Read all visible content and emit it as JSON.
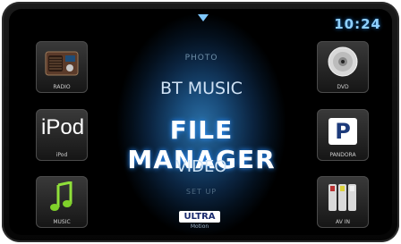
{
  "clock": "10:24",
  "menu": {
    "photo": "PHOTO",
    "bt_music": "BT MUSIC",
    "file_manager": "FILE MANAGER",
    "video": "VIDEO",
    "setup": "SET UP"
  },
  "left_tiles": [
    {
      "label": "RADIO",
      "icon": "radio-icon"
    },
    {
      "label": "iPod",
      "icon_text": "iPod",
      "icon": "ipod-icon"
    },
    {
      "label": "MUSIC",
      "icon": "music-note-icon"
    }
  ],
  "right_tiles": [
    {
      "label": "DVD",
      "icon": "disc-icon"
    },
    {
      "label": "PANDORA",
      "icon_text": "P",
      "icon": "pandora-icon"
    },
    {
      "label": "AV IN",
      "icon": "av-plugs-icon"
    }
  ],
  "logo": {
    "main": "ULTRA",
    "sub": "Motion"
  }
}
